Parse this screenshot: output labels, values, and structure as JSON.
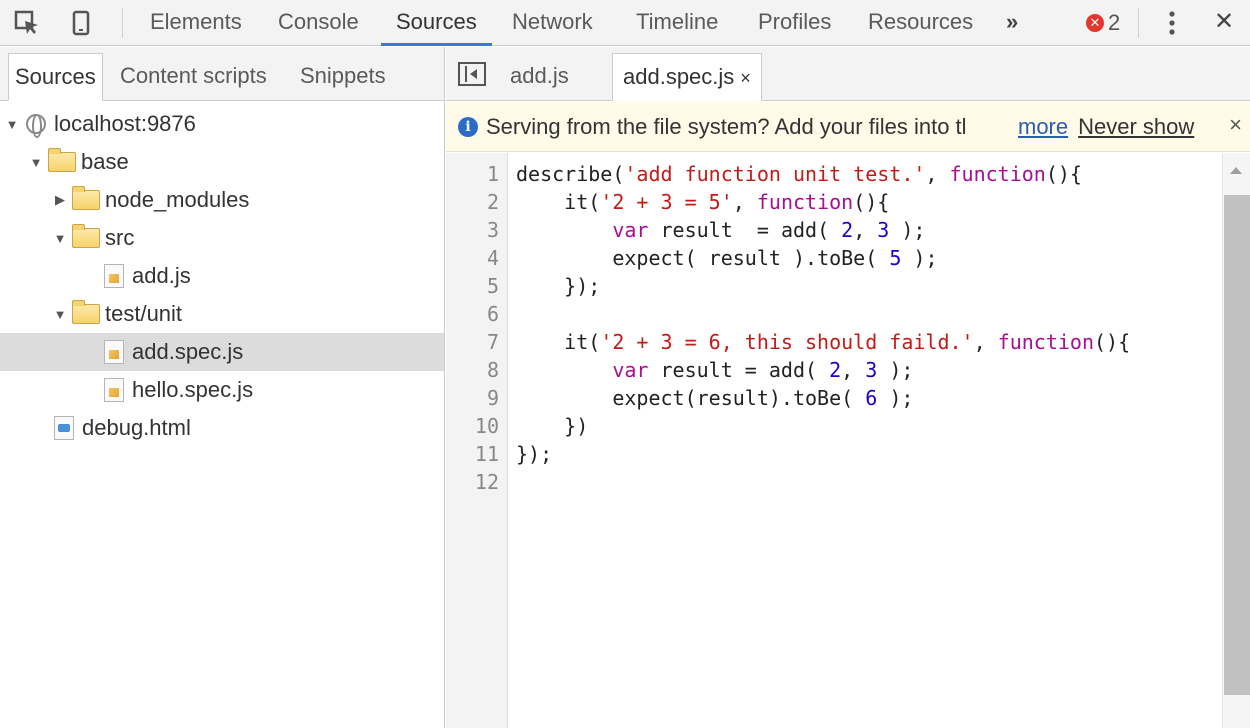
{
  "toolbar": {
    "inspect_icon": "inspect-element-icon",
    "device_icon": "device-mode-icon",
    "tabs": [
      "Elements",
      "Console",
      "Sources",
      "Network",
      "Timeline",
      "Profiles",
      "Resources"
    ],
    "active_tab": "Sources",
    "more_tabs": "»",
    "error_count": "2",
    "menu_icon": "kebab-menu-icon",
    "close": "✕"
  },
  "navigator": {
    "tabs": [
      "Sources",
      "Content scripts",
      "Snippets"
    ],
    "active_tab": "Sources",
    "tree": [
      {
        "label": "localhost:9876",
        "icon": "globe-icon",
        "expanded": true
      },
      {
        "label": "base",
        "icon": "folder-icon",
        "expanded": true
      },
      {
        "label": "node_modules",
        "icon": "folder-icon",
        "expanded": false
      },
      {
        "label": "src",
        "icon": "folder-icon",
        "expanded": true
      },
      {
        "label": "add.js",
        "icon": "script-file-icon"
      },
      {
        "label": "test/unit",
        "icon": "folder-icon",
        "expanded": true
      },
      {
        "label": "add.spec.js",
        "icon": "script-file-icon",
        "selected": true
      },
      {
        "label": "hello.spec.js",
        "icon": "script-file-icon"
      },
      {
        "label": "debug.html",
        "icon": "html-file-icon"
      }
    ]
  },
  "editor": {
    "file_tabs": [
      "add.js",
      "add.spec.js"
    ],
    "active_file": "add.spec.js",
    "tab_close": "×",
    "infobar": {
      "message": "Serving from the file system? Add your files into tl",
      "more_link": "more",
      "never_show": "Never show",
      "close": "×"
    },
    "line_numbers": [
      "1",
      "2",
      "3",
      "4",
      "5",
      "6",
      "7",
      "8",
      "9",
      "10",
      "11",
      "12"
    ],
    "code": [
      "describe('add function unit test.', function(){",
      "    it('2 + 3 = 5', function(){",
      "        var result  = add( 2, 3 );",
      "        expect( result ).toBe( 5 );",
      "    });",
      "",
      "    it('2 + 3 = 6, this should faild.', function(){",
      "        var result = add( 2, 3 );",
      "        expect(result).toBe( 6 );",
      "    })",
      "});",
      ""
    ]
  },
  "colors": {
    "keyword": "#aa0d91",
    "string": "#c41a16",
    "number": "#1c00cf",
    "active_tab_underline": "#3879d9",
    "error_badge": "#e5362d",
    "selected_row": "#dcdcdc",
    "infobar_bg": "#fffbe8"
  }
}
